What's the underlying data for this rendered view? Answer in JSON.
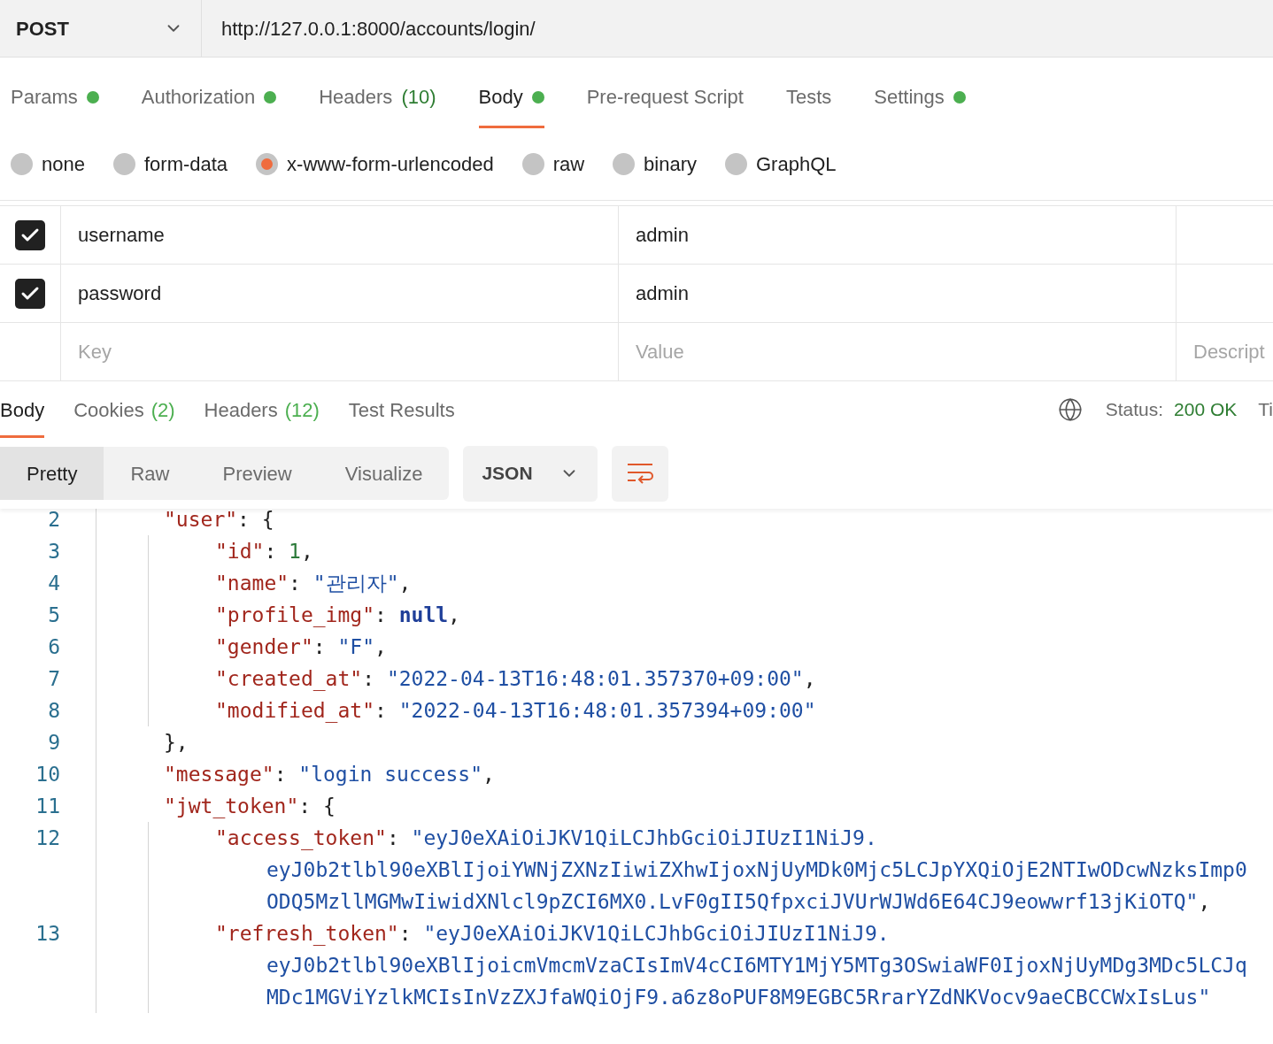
{
  "request": {
    "method": "POST",
    "url": "http://127.0.0.1:8000/accounts/login/"
  },
  "request_tabs": [
    {
      "label": "Params",
      "dot": true,
      "selected": false
    },
    {
      "label": "Authorization",
      "dot": true,
      "selected": false
    },
    {
      "label": "Headers",
      "count": "(10)",
      "dot": false,
      "selected": false
    },
    {
      "label": "Body",
      "dot": true,
      "selected": true
    },
    {
      "label": "Pre-request Script",
      "dot": false,
      "selected": false
    },
    {
      "label": "Tests",
      "dot": false,
      "selected": false
    },
    {
      "label": "Settings",
      "dot": true,
      "selected": false
    }
  ],
  "body_types": [
    {
      "label": "none",
      "selected": false
    },
    {
      "label": "form-data",
      "selected": false
    },
    {
      "label": "x-www-form-urlencoded",
      "selected": true
    },
    {
      "label": "raw",
      "selected": false
    },
    {
      "label": "binary",
      "selected": false
    },
    {
      "label": "GraphQL",
      "selected": false
    }
  ],
  "params": [
    {
      "checked": true,
      "key": "username",
      "value": "admin"
    },
    {
      "checked": true,
      "key": "password",
      "value": "admin"
    }
  ],
  "new_param": {
    "key_placeholder": "Key",
    "value_placeholder": "Value",
    "description_placeholder": "Descript"
  },
  "response_tabs": [
    {
      "label": "Body",
      "selected": true
    },
    {
      "label": "Cookies",
      "count": "(2)",
      "selected": false
    },
    {
      "label": "Headers",
      "count": "(12)",
      "selected": false
    },
    {
      "label": "Test Results",
      "selected": false
    }
  ],
  "status": {
    "label": "Status:",
    "value": "200 OK",
    "next": "Ti"
  },
  "view_modes": [
    {
      "label": "Pretty",
      "selected": true
    },
    {
      "label": "Raw",
      "selected": false
    },
    {
      "label": "Preview",
      "selected": false
    },
    {
      "label": "Visualize",
      "selected": false
    }
  ],
  "format": "JSON",
  "code": [
    {
      "number": "2",
      "tokens": [
        {
          "kind": "key",
          "text": "\"user\""
        },
        {
          "kind": "punct",
          "text": ": {"
        }
      ],
      "children": [
        {
          "number": "3",
          "tokens": [
            {
              "kind": "key",
              "text": "\"id\""
            },
            {
              "kind": "punct",
              "text": ": "
            },
            {
              "kind": "number",
              "text": "1"
            },
            {
              "kind": "punct",
              "text": ","
            }
          ]
        },
        {
          "number": "4",
          "tokens": [
            {
              "kind": "key",
              "text": "\"name\""
            },
            {
              "kind": "punct",
              "text": ": "
            },
            {
              "kind": "string",
              "text": "\"관리자\""
            },
            {
              "kind": "punct",
              "text": ","
            }
          ]
        },
        {
          "number": "5",
          "tokens": [
            {
              "kind": "key",
              "text": "\"profile_img\""
            },
            {
              "kind": "punct",
              "text": ": "
            },
            {
              "kind": "null",
              "text": "null"
            },
            {
              "kind": "punct",
              "text": ","
            }
          ]
        },
        {
          "number": "6",
          "tokens": [
            {
              "kind": "key",
              "text": "\"gender\""
            },
            {
              "kind": "punct",
              "text": ": "
            },
            {
              "kind": "string",
              "text": "\"F\""
            },
            {
              "kind": "punct",
              "text": ","
            }
          ]
        },
        {
          "number": "7",
          "tokens": [
            {
              "kind": "key",
              "text": "\"created_at\""
            },
            {
              "kind": "punct",
              "text": ": "
            },
            {
              "kind": "string",
              "text": "\"2022-04-13T16:48:01.357370+09:00\""
            },
            {
              "kind": "punct",
              "text": ","
            }
          ]
        },
        {
          "number": "8",
          "tokens": [
            {
              "kind": "key",
              "text": "\"modified_at\""
            },
            {
              "kind": "punct",
              "text": ": "
            },
            {
              "kind": "string",
              "text": "\"2022-04-13T16:48:01.357394+09:00\""
            }
          ]
        }
      ]
    },
    {
      "number": "9",
      "tokens": [
        {
          "kind": "punct",
          "text": "},"
        }
      ]
    },
    {
      "number": "10",
      "tokens": [
        {
          "kind": "key",
          "text": "\"message\""
        },
        {
          "kind": "punct",
          "text": ": "
        },
        {
          "kind": "string",
          "text": "\"login success\""
        },
        {
          "kind": "punct",
          "text": ","
        }
      ]
    },
    {
      "number": "11",
      "tokens": [
        {
          "kind": "key",
          "text": "\"jwt_token\""
        },
        {
          "kind": "punct",
          "text": ": {"
        }
      ],
      "children": [
        {
          "number": "12",
          "tokens": [
            {
              "kind": "key",
              "text": "\"access_token\""
            },
            {
              "kind": "punct",
              "text": ": "
            },
            {
              "kind": "string",
              "text": "\"eyJ0eXAiOiJKV1QiLCJhbGciOiJIUzI1NiJ9."
            }
          ],
          "wrapped": [
            [
              {
                "kind": "string",
                "text": "eyJ0b2tlbl90eXBlIjoiYWNjZXNzIiwiZXhwIjoxNjUyMDk0Mjc5LCJpYXQiOjE2NTIwODcwNzksImp0"
              }
            ],
            [
              {
                "kind": "string",
                "text": "ODQ5MzllMGMwIiwidXNlcl9pZCI6MX0.LvF0gII5QfpxciJVUrWJWd6E64CJ9eowwrf13jKiOTQ\""
              },
              {
                "kind": "punct",
                "text": ","
              }
            ]
          ]
        },
        {
          "number": "13",
          "tokens": [
            {
              "kind": "key",
              "text": "\"refresh_token\""
            },
            {
              "kind": "punct",
              "text": ": "
            },
            {
              "kind": "string",
              "text": "\"eyJ0eXAiOiJKV1QiLCJhbGciOiJIUzI1NiJ9."
            }
          ],
          "wrapped": [
            [
              {
                "kind": "string",
                "text": "eyJ0b2tlbl90eXBlIjoicmVmcmVzaCIsImV4cCI6MTY1MjY5MTg3OSwiaWF0IjoxNjUyMDg3MDc5LCJq"
              }
            ],
            [
              {
                "kind": "string",
                "text": "MDc1MGViYzlkMCIsInVzZXJfaWQiOjF9.a6z8oPUF8M9EGBC5RrarYZdNKVocv9aeCBCCWxIsLus\""
              }
            ]
          ]
        }
      ]
    }
  ]
}
